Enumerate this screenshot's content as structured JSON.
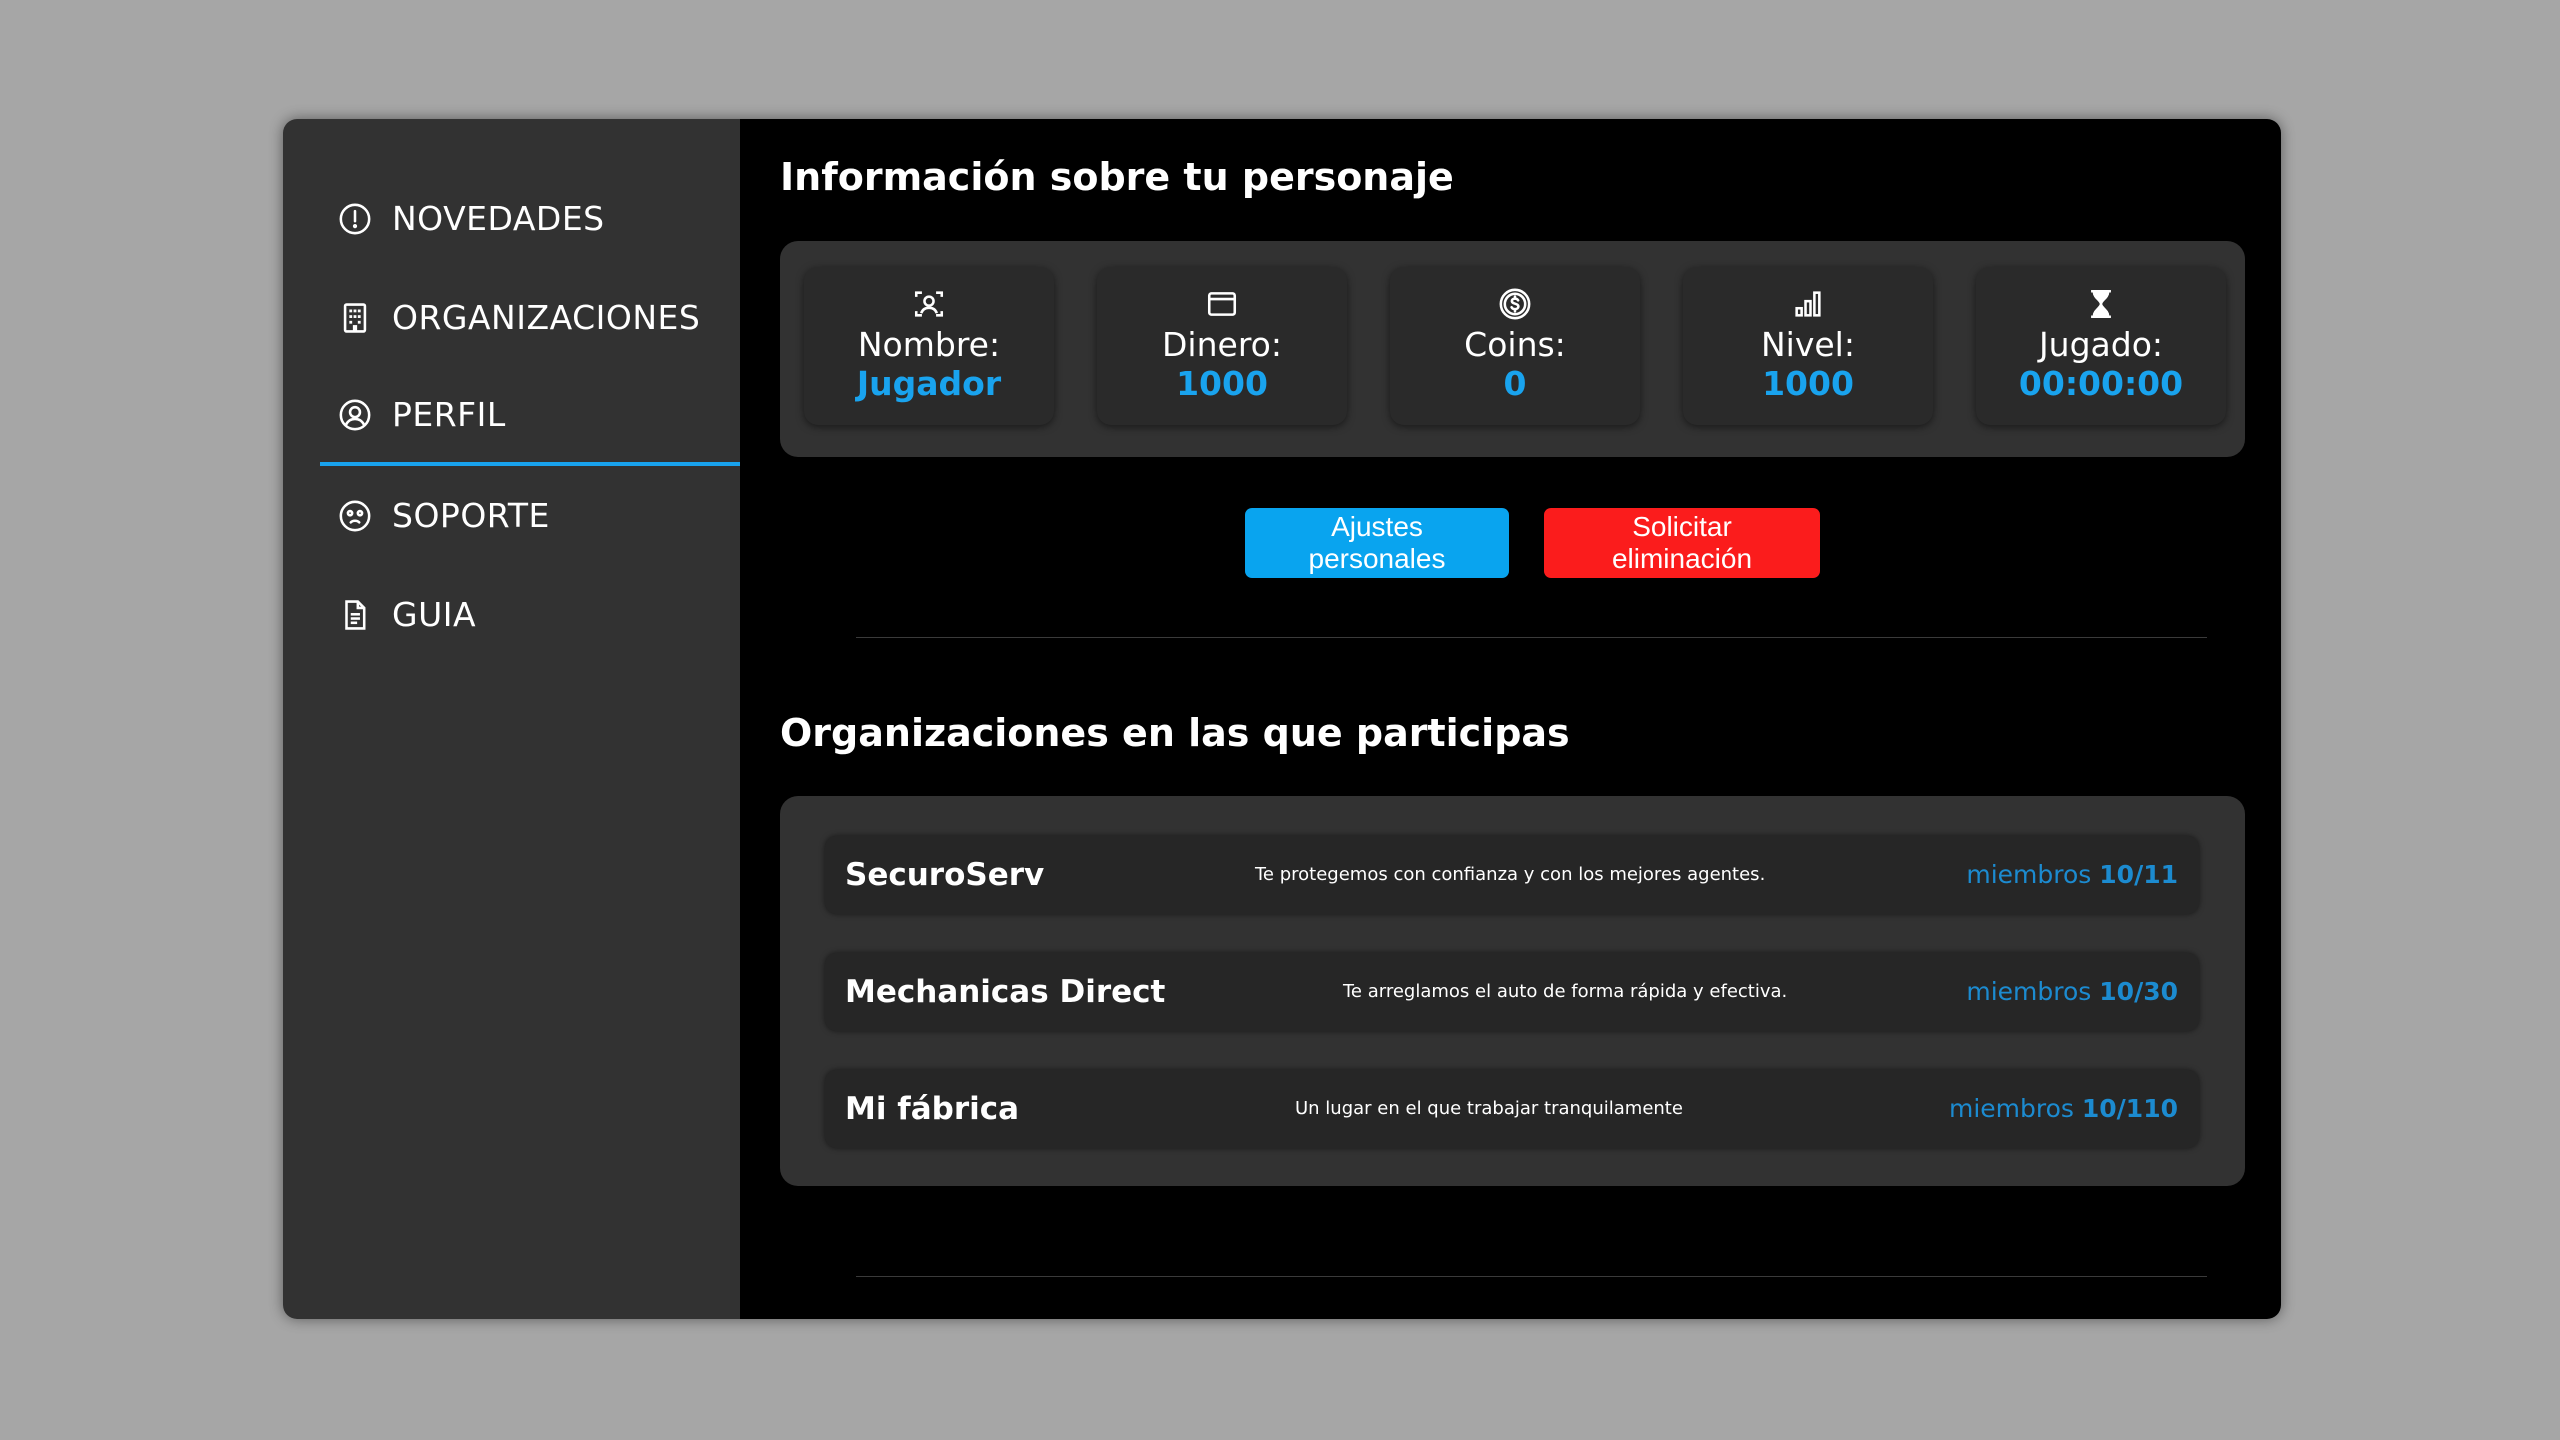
{
  "colors": {
    "accent": "#19a3ee",
    "danger": "#fb1c1c",
    "members": "#1c8bd0",
    "sidebar_bg": "#323232",
    "main_bg": "#000000",
    "backdrop": "#a6a6a6"
  },
  "sidebar": {
    "items": [
      {
        "label": "NOVEDADES",
        "icon": "exclamation-circle-icon",
        "active": false
      },
      {
        "label": "ORGANIZACIONES",
        "icon": "building-icon",
        "active": false
      },
      {
        "label": "PERFIL",
        "icon": "user-circle-icon",
        "active": true
      },
      {
        "label": "SOPORTE",
        "icon": "face-icon",
        "active": false
      },
      {
        "label": "GUIA",
        "icon": "document-icon",
        "active": false
      }
    ]
  },
  "character": {
    "title": "Información sobre tu personaje",
    "stats": [
      {
        "label": "Nombre:",
        "value": "Jugador",
        "icon": "person-scan-icon"
      },
      {
        "label": "Dinero:",
        "value": "1000",
        "icon": "wallet-icon"
      },
      {
        "label": "Coins:",
        "value": "0",
        "icon": "coin-icon"
      },
      {
        "label": "Nivel:",
        "value": "1000",
        "icon": "signal-bars-icon"
      },
      {
        "label": "Jugado:",
        "value": "00:00:00",
        "icon": "hourglass-icon"
      }
    ]
  },
  "actions": {
    "settings_label": "Ajustes personales",
    "delete_label": "Solicitar eliminación"
  },
  "organizations": {
    "title": "Organizaciones en las que participas",
    "members_word": "miembros",
    "items": [
      {
        "name": "SecuroServ",
        "description": "Te protegemos con confianza y con los mejores agentes.",
        "members": "10/11"
      },
      {
        "name": "Mechanicas Direct",
        "description": "Te arreglamos el auto de forma rápida y efectiva.",
        "members": "10/30"
      },
      {
        "name": "Mi fábrica",
        "description": "Un lugar en el que trabajar tranquilamente",
        "members": "10/110"
      }
    ]
  }
}
